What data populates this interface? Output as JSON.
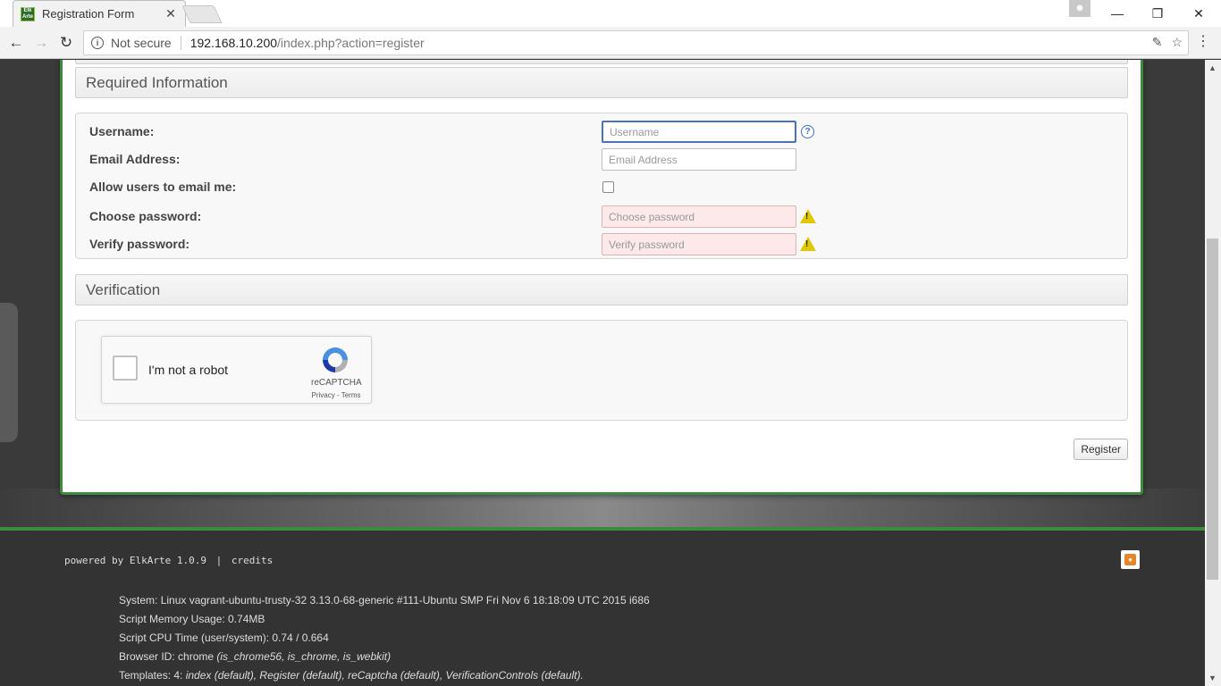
{
  "browser": {
    "tab_title": "Registration Form",
    "tab_close": "✕",
    "favicon_text_top": "Elk",
    "favicon_text_bottom": "Arte",
    "security_label": "Not secure",
    "url_host": "192.168.10.200",
    "url_path": "/index.php?action=register",
    "window_controls": [
      "minimize-icon",
      "restore-icon",
      "close-icon"
    ]
  },
  "sections": {
    "required_title": "Required Information",
    "verification_title": "Verification"
  },
  "form": {
    "username_label": "Username:",
    "username_placeholder": "Username",
    "email_label": "Email Address:",
    "email_placeholder": "Email Address",
    "allow_email_label": "Allow users to email me:",
    "password_label": "Choose password:",
    "password_placeholder": "Choose password",
    "verify_label": "Verify password:",
    "verify_placeholder": "Verify password",
    "help_glyph": "?",
    "warn_glyph": "!"
  },
  "recaptcha": {
    "label": "I'm not a robot",
    "brand": "reCAPTCHA",
    "links": "Privacy - Terms"
  },
  "register_label": "Register",
  "footer": {
    "powered_by": "powered by ElkArte 1.0.9",
    "separator": "|",
    "credits": "credits",
    "system_label": "System:",
    "system_value": "Linux vagrant-ubuntu-trusty-32 3.13.0-68-generic #111-Ubuntu SMP Fri Nov 6 18:18:09 UTC 2015 i686",
    "memory_label": "Script Memory Usage:",
    "memory_value": "0.74MB",
    "cpu_label": "Script CPU Time (user/system):",
    "cpu_value": "0.74 / 0.664",
    "browser_label": "Browser ID:",
    "browser_value": "chrome",
    "browser_detail": "(is_chrome56, is_chrome, is_webkit)",
    "templates_label": "Templates: 4:",
    "templates_value": "index (default), Register (default), reCaptcha (default), VerificationControls (default)."
  },
  "colors": {
    "accent_green": "#3c8a3c",
    "focus_blue": "#4a72b8",
    "error_pink": "#fde9e9",
    "warning_yellow": "#e2c800",
    "rss_orange": "#e6862a"
  }
}
